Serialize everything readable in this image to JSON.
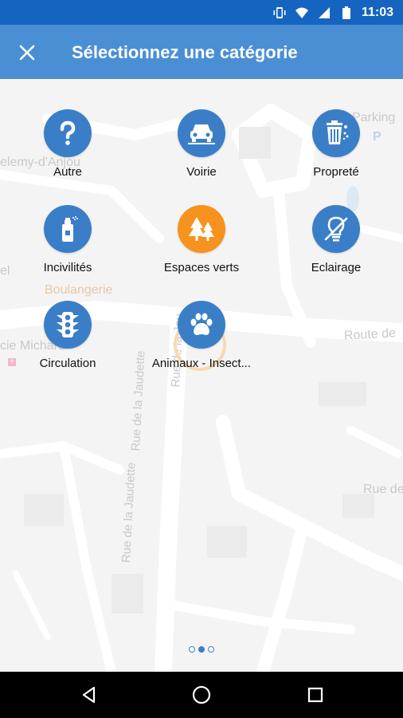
{
  "status": {
    "time": "11:03",
    "icons": [
      "vibrate-icon",
      "wifi-icon",
      "signal-icon",
      "battery-icon"
    ]
  },
  "appbar": {
    "title": "Sélectionnez une catégorie",
    "close_icon": "close-icon"
  },
  "map_labels": {
    "parking": "Parking",
    "p": "P",
    "anjou": "elemy-d'Anjou",
    "el": "el",
    "boulangerie": "Boulangerie",
    "route": "Route de",
    "michard": "cie Michard",
    "rue_de": "Rue de",
    "jaudette_1": "Rue de la Jaudette",
    "jaudette_2": "Rue de la Jaudette",
    "jaudette_3": "Rue de la Jau"
  },
  "categories": [
    {
      "label": "Autre",
      "icon": "question-icon",
      "color": "#3b7ec8"
    },
    {
      "label": "Voirie",
      "icon": "car-icon",
      "color": "#3b7ec8"
    },
    {
      "label": "Propreté",
      "icon": "trash-icon",
      "color": "#3b7ec8"
    },
    {
      "label": "Incivilités",
      "icon": "spray-can-icon",
      "color": "#3b7ec8"
    },
    {
      "label": "Espaces verts",
      "icon": "trees-icon",
      "color": "#f7921e"
    },
    {
      "label": "Eclairage",
      "icon": "no-light-bulb-icon",
      "color": "#3b7ec8"
    },
    {
      "label": "Circulation",
      "icon": "traffic-light-icon",
      "color": "#3b7ec8"
    },
    {
      "label": "Animaux - Insect...",
      "icon": "paw-icon",
      "color": "#3b7ec8"
    }
  ],
  "pagination": {
    "total": 3,
    "active": 2
  },
  "navbar": {
    "buttons": [
      "back-icon",
      "home-icon",
      "recents-icon"
    ]
  }
}
